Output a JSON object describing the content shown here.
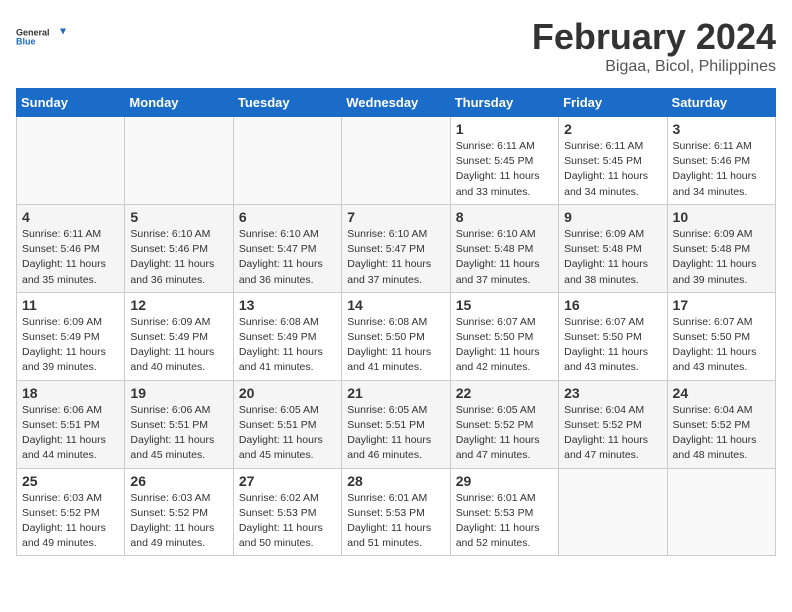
{
  "logo": {
    "line1": "General",
    "line2": "Blue"
  },
  "title": "February 2024",
  "subtitle": "Bigaa, Bicol, Philippines",
  "days_of_week": [
    "Sunday",
    "Monday",
    "Tuesday",
    "Wednesday",
    "Thursday",
    "Friday",
    "Saturday"
  ],
  "weeks": [
    [
      {
        "day": "",
        "info": ""
      },
      {
        "day": "",
        "info": ""
      },
      {
        "day": "",
        "info": ""
      },
      {
        "day": "",
        "info": ""
      },
      {
        "day": "1",
        "info": "Sunrise: 6:11 AM\nSunset: 5:45 PM\nDaylight: 11 hours and 33 minutes."
      },
      {
        "day": "2",
        "info": "Sunrise: 6:11 AM\nSunset: 5:45 PM\nDaylight: 11 hours and 34 minutes."
      },
      {
        "day": "3",
        "info": "Sunrise: 6:11 AM\nSunset: 5:46 PM\nDaylight: 11 hours and 34 minutes."
      }
    ],
    [
      {
        "day": "4",
        "info": "Sunrise: 6:11 AM\nSunset: 5:46 PM\nDaylight: 11 hours and 35 minutes."
      },
      {
        "day": "5",
        "info": "Sunrise: 6:10 AM\nSunset: 5:46 PM\nDaylight: 11 hours and 36 minutes."
      },
      {
        "day": "6",
        "info": "Sunrise: 6:10 AM\nSunset: 5:47 PM\nDaylight: 11 hours and 36 minutes."
      },
      {
        "day": "7",
        "info": "Sunrise: 6:10 AM\nSunset: 5:47 PM\nDaylight: 11 hours and 37 minutes."
      },
      {
        "day": "8",
        "info": "Sunrise: 6:10 AM\nSunset: 5:48 PM\nDaylight: 11 hours and 37 minutes."
      },
      {
        "day": "9",
        "info": "Sunrise: 6:09 AM\nSunset: 5:48 PM\nDaylight: 11 hours and 38 minutes."
      },
      {
        "day": "10",
        "info": "Sunrise: 6:09 AM\nSunset: 5:48 PM\nDaylight: 11 hours and 39 minutes."
      }
    ],
    [
      {
        "day": "11",
        "info": "Sunrise: 6:09 AM\nSunset: 5:49 PM\nDaylight: 11 hours and 39 minutes."
      },
      {
        "day": "12",
        "info": "Sunrise: 6:09 AM\nSunset: 5:49 PM\nDaylight: 11 hours and 40 minutes."
      },
      {
        "day": "13",
        "info": "Sunrise: 6:08 AM\nSunset: 5:49 PM\nDaylight: 11 hours and 41 minutes."
      },
      {
        "day": "14",
        "info": "Sunrise: 6:08 AM\nSunset: 5:50 PM\nDaylight: 11 hours and 41 minutes."
      },
      {
        "day": "15",
        "info": "Sunrise: 6:07 AM\nSunset: 5:50 PM\nDaylight: 11 hours and 42 minutes."
      },
      {
        "day": "16",
        "info": "Sunrise: 6:07 AM\nSunset: 5:50 PM\nDaylight: 11 hours and 43 minutes."
      },
      {
        "day": "17",
        "info": "Sunrise: 6:07 AM\nSunset: 5:50 PM\nDaylight: 11 hours and 43 minutes."
      }
    ],
    [
      {
        "day": "18",
        "info": "Sunrise: 6:06 AM\nSunset: 5:51 PM\nDaylight: 11 hours and 44 minutes."
      },
      {
        "day": "19",
        "info": "Sunrise: 6:06 AM\nSunset: 5:51 PM\nDaylight: 11 hours and 45 minutes."
      },
      {
        "day": "20",
        "info": "Sunrise: 6:05 AM\nSunset: 5:51 PM\nDaylight: 11 hours and 45 minutes."
      },
      {
        "day": "21",
        "info": "Sunrise: 6:05 AM\nSunset: 5:51 PM\nDaylight: 11 hours and 46 minutes."
      },
      {
        "day": "22",
        "info": "Sunrise: 6:05 AM\nSunset: 5:52 PM\nDaylight: 11 hours and 47 minutes."
      },
      {
        "day": "23",
        "info": "Sunrise: 6:04 AM\nSunset: 5:52 PM\nDaylight: 11 hours and 47 minutes."
      },
      {
        "day": "24",
        "info": "Sunrise: 6:04 AM\nSunset: 5:52 PM\nDaylight: 11 hours and 48 minutes."
      }
    ],
    [
      {
        "day": "25",
        "info": "Sunrise: 6:03 AM\nSunset: 5:52 PM\nDaylight: 11 hours and 49 minutes."
      },
      {
        "day": "26",
        "info": "Sunrise: 6:03 AM\nSunset: 5:52 PM\nDaylight: 11 hours and 49 minutes."
      },
      {
        "day": "27",
        "info": "Sunrise: 6:02 AM\nSunset: 5:53 PM\nDaylight: 11 hours and 50 minutes."
      },
      {
        "day": "28",
        "info": "Sunrise: 6:01 AM\nSunset: 5:53 PM\nDaylight: 11 hours and 51 minutes."
      },
      {
        "day": "29",
        "info": "Sunrise: 6:01 AM\nSunset: 5:53 PM\nDaylight: 11 hours and 52 minutes."
      },
      {
        "day": "",
        "info": ""
      },
      {
        "day": "",
        "info": ""
      }
    ]
  ]
}
